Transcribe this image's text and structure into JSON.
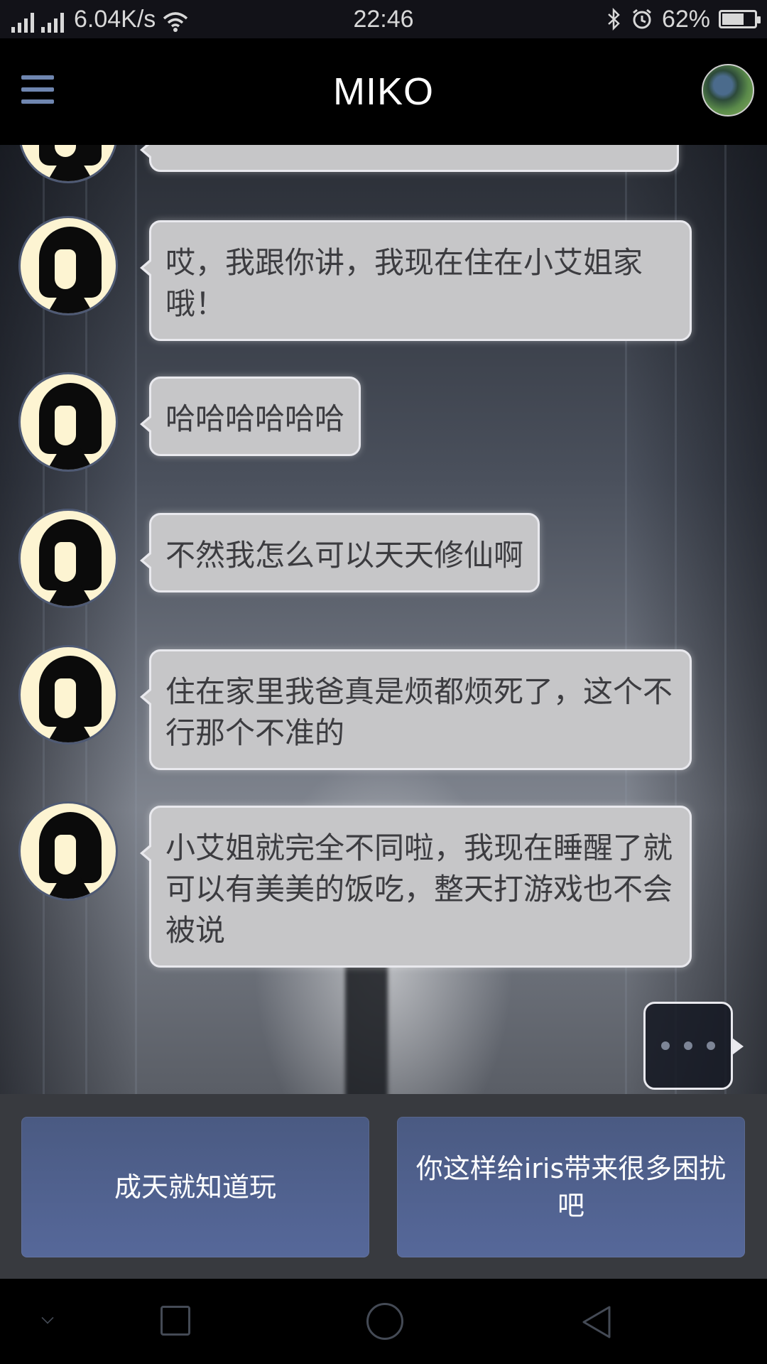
{
  "status_bar": {
    "network_speed": "6.04K/s",
    "time": "22:46",
    "battery_percent": "62%",
    "battery_level": 0.62,
    "icons": [
      "signal-icon",
      "signal-icon",
      "wifi-icon",
      "bluetooth-icon",
      "alarm-icon",
      "battery-icon"
    ]
  },
  "header": {
    "title": "MIKO",
    "menu_icon": "menu-icon",
    "profile_icon": "profile-avatar"
  },
  "messages": [
    {
      "sender": "miko",
      "text": ""
    },
    {
      "sender": "miko",
      "text": "哎，我跟你讲，我现在住在小艾姐家哦！"
    },
    {
      "sender": "miko",
      "text": "哈哈哈哈哈哈"
    },
    {
      "sender": "miko",
      "text": "不然我怎么可以天天修仙啊"
    },
    {
      "sender": "miko",
      "text": "住在家里我爸真是烦都烦死了，这个不行那个不准的"
    },
    {
      "sender": "miko",
      "text": "小艾姐就完全不同啦，我现在睡醒了就可以有美美的饭吃，整天打游戏也不会被说"
    }
  ],
  "typing_indicator": "...",
  "replies": [
    {
      "label": "成天就知道玩"
    },
    {
      "label": "你这样给iris带来很多困扰吧"
    }
  ],
  "nav_bar": {
    "icons": [
      "chevron-down-icon",
      "square-icon",
      "circle-icon",
      "triangle-back-icon"
    ]
  },
  "colors": {
    "bubble": "#c6c6c8",
    "reply_button": "#4a5a82",
    "menu_icon": "#6f86b0"
  }
}
